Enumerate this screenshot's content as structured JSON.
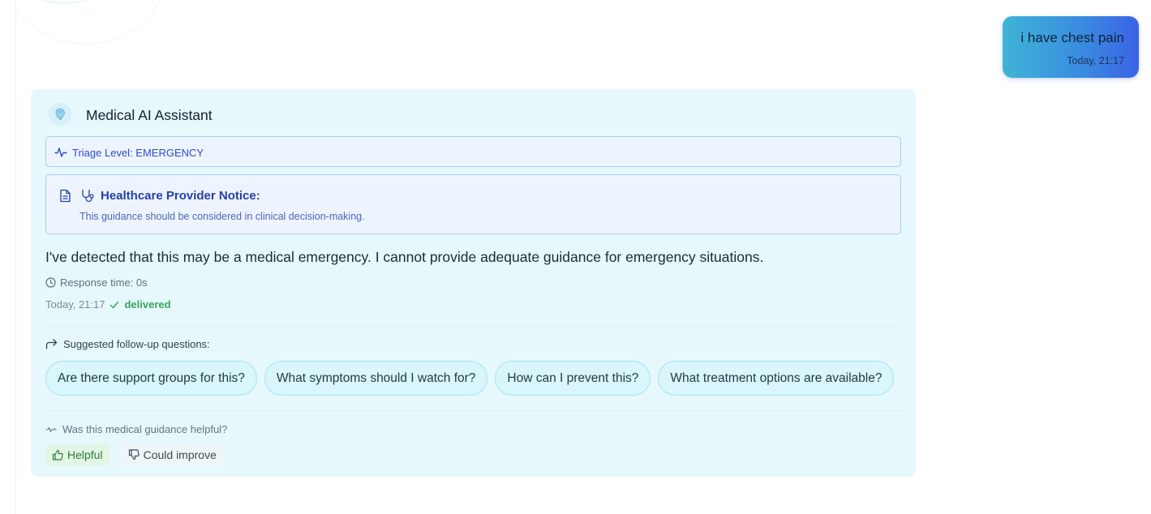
{
  "user_message": {
    "text": "i have chest pain",
    "time": "Today, 21:17"
  },
  "assistant": {
    "name": "Medical AI Assistant",
    "avatar_icon": "brain-icon",
    "triage_label": "Triage Level: EMERGENCY",
    "notice": {
      "title": "Healthcare Provider Notice:",
      "body": "This guidance should be considered in clinical decision-making."
    },
    "message": "I've detected that this may be a medical emergency. I cannot provide adequate guidance for emergency situations.",
    "response_time": "Response time: 0s",
    "timestamp": "Today, 21:17",
    "status": "delivered",
    "suggestions_heading": "Suggested follow-up questions:",
    "suggestions": [
      "Are there support groups for this?",
      "What symptoms should I watch for?",
      "How can I prevent this?",
      "What treatment options are available?"
    ],
    "feedback_question": "Was this medical guidance helpful?",
    "feedback_helpful": "Helpful",
    "feedback_improve": "Could improve"
  },
  "colors": {
    "card_bg": "#e6f8fc",
    "triage_text": "#2b4cc8",
    "delivered": "#3aa35c",
    "user_bubble_start": "#3fb4d6",
    "user_bubble_end": "#3b63e6"
  }
}
